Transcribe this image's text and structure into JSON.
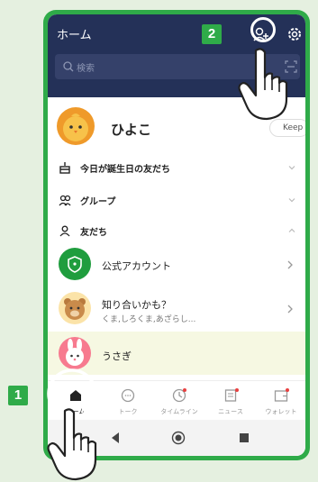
{
  "header": {
    "title": "ホーム"
  },
  "search": {
    "placeholder": "検索"
  },
  "profile": {
    "name": "ひよこ",
    "keep_label": "Keep"
  },
  "sections": [
    {
      "label": "今日が誕生日の友だち",
      "icon": "birthday-cake-icon",
      "expanded": false
    },
    {
      "label": "グループ",
      "icon": "group-icon",
      "expanded": false
    },
    {
      "label": "友だち",
      "icon": "friends-icon",
      "expanded": true
    }
  ],
  "friends": [
    {
      "name": "公式アカウント",
      "sub": "",
      "icon": "shield-icon"
    },
    {
      "name": "知り合いかも？",
      "sub": "くま,しろくま,あざらし...",
      "icon": "bear-avatar"
    },
    {
      "name": "うさぎ",
      "sub": "",
      "icon": "rabbit-avatar"
    }
  ],
  "tabs": [
    {
      "label": "ホーム",
      "icon": "home-icon",
      "active": true,
      "badge": false
    },
    {
      "label": "トーク",
      "icon": "chat-icon",
      "active": false,
      "badge": false
    },
    {
      "label": "タイムライン",
      "icon": "timeline-icon",
      "active": false,
      "badge": true
    },
    {
      "label": "ニュース",
      "icon": "news-icon",
      "active": false,
      "badge": true
    },
    {
      "label": "ウォレット",
      "icon": "wallet-icon",
      "active": false,
      "badge": true
    }
  ],
  "markers": {
    "one": "1",
    "two": "2"
  },
  "colors": {
    "accent_green": "#2fab49",
    "header_navy": "#243158",
    "badge_red": "#e84040",
    "highlight": "#f6f8e2"
  }
}
